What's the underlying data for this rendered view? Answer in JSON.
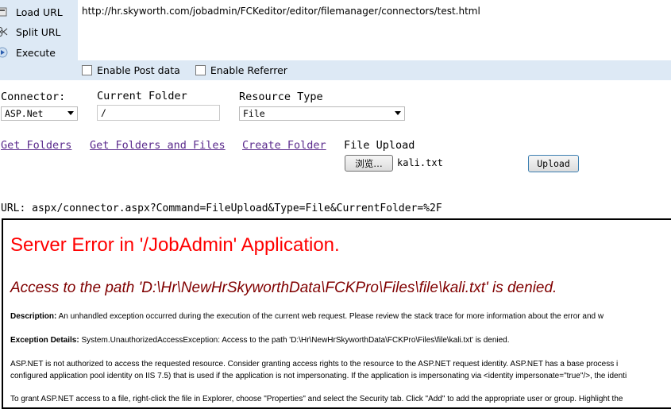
{
  "hackbar": {
    "load_url": "Load URL",
    "split_url": "Split URL",
    "execute": "Execute",
    "url": "http://hr.skyworth.com/jobadmin/FCKeditor/editor/filemanager/connectors/test.html",
    "enable_post": "Enable Post data",
    "enable_referrer": "Enable Referrer"
  },
  "form": {
    "connector_label": "Connector:",
    "connector_value": "ASP.Net",
    "current_folder_label": "Current Folder",
    "current_folder_value": "/",
    "resource_type_label": "Resource Type",
    "resource_type_value": "File",
    "get_folders": "Get Folders",
    "get_folders_files": "Get Folders and Files",
    "create_folder": "Create Folder",
    "file_upload_label": "File Upload",
    "browse_button": "浏览…",
    "chosen_file": "kali.txt",
    "upload_button": "Upload",
    "url_line": "URL: aspx/connector.aspx?Command=FileUpload&Type=File&CurrentFolder=%2F"
  },
  "error": {
    "title": "Server Error in '/JobAdmin' Application.",
    "subtitle": "Access to the path 'D:\\Hr\\NewHrSkyworthData\\FCKPro\\Files\\file\\kali.txt' is denied.",
    "description_label": "Description:",
    "description_text": " An unhandled exception occurred during the execution of the current web request. Please review the stack trace for more information about the error and w",
    "exception_label": "Exception Details:",
    "exception_text": " System.UnauthorizedAccessException: Access to the path 'D:\\Hr\\NewHrSkyworthData\\FCKPro\\Files\\file\\kali.txt' is denied.",
    "para1_line1": "ASP.NET is not authorized to access the requested resource. Consider granting access rights to the resource to the ASP.NET request identity. ASP.NET has a base process i",
    "para1_line2": "configured application pool identity on IIS 7.5) that is used if the application is not impersonating. If the application is impersonating via <identity impersonate=\"true\"/>, the identi",
    "para2_line1": "To grant ASP.NET access to a file, right-click the file in Explorer, choose \"Properties\" and select the Security tab. Click \"Add\" to add the appropriate user or group. Highlight the"
  },
  "colors": {
    "hackbar_bg": "#dde9f5",
    "link": "#5a2a8c",
    "error_title": "#ff0000",
    "error_subtitle": "#800000"
  }
}
